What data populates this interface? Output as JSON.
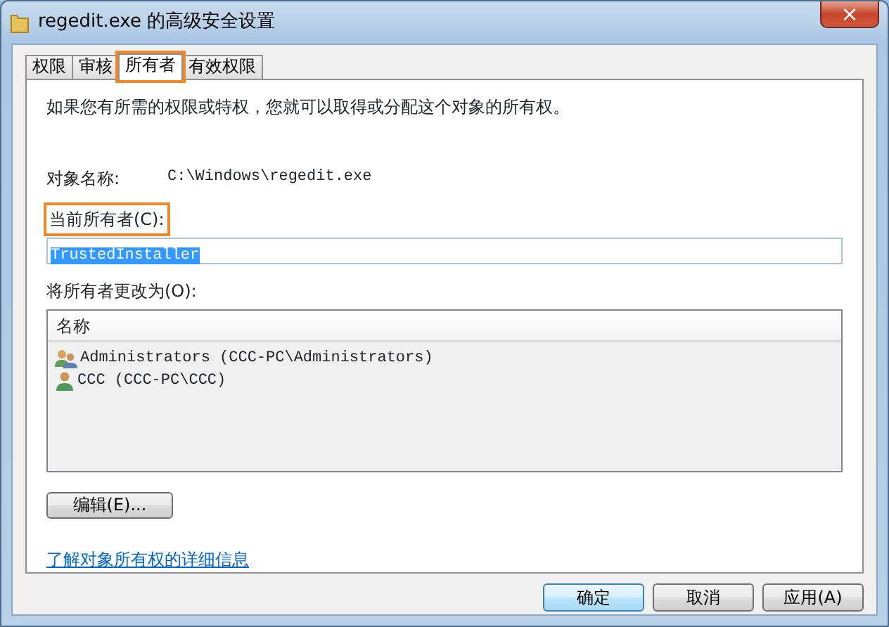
{
  "window": {
    "title": "regedit.exe 的高级安全设置",
    "close": "×"
  },
  "tabs": [
    {
      "label": "权限",
      "selected": false,
      "highlighted": false
    },
    {
      "label": "审核",
      "selected": false,
      "highlighted": false
    },
    {
      "label": "所有者",
      "selected": true,
      "highlighted": true
    },
    {
      "label": "有效权限",
      "selected": false,
      "highlighted": false
    }
  ],
  "description": "如果您有所需的权限或特权，您就可以取得或分配这个对象的所有权。",
  "object_name": {
    "label": "对象名称:",
    "value": "C:\\Windows\\regedit.exe"
  },
  "current_owner": {
    "label": "当前所有者(C):",
    "value": "TrustedInstaller",
    "text_selected": true,
    "highlighted": true
  },
  "change_owner": {
    "label": "将所有者更改为(O):",
    "columns": [
      "名称"
    ],
    "rows": [
      {
        "kind": "group",
        "name": "Administrators (CCC-PC\\Administrators)",
        "selected": false
      },
      {
        "kind": "user",
        "name": "CCC (CCC-PC\\CCC)",
        "selected": false
      }
    ]
  },
  "edit_button": "编辑(E)...",
  "link": "了解对象所有权的详细信息",
  "buttons": [
    {
      "label": "确定",
      "default": true
    },
    {
      "label": "取消",
      "default": false
    },
    {
      "label": "应用(A)",
      "default": false
    }
  ]
}
